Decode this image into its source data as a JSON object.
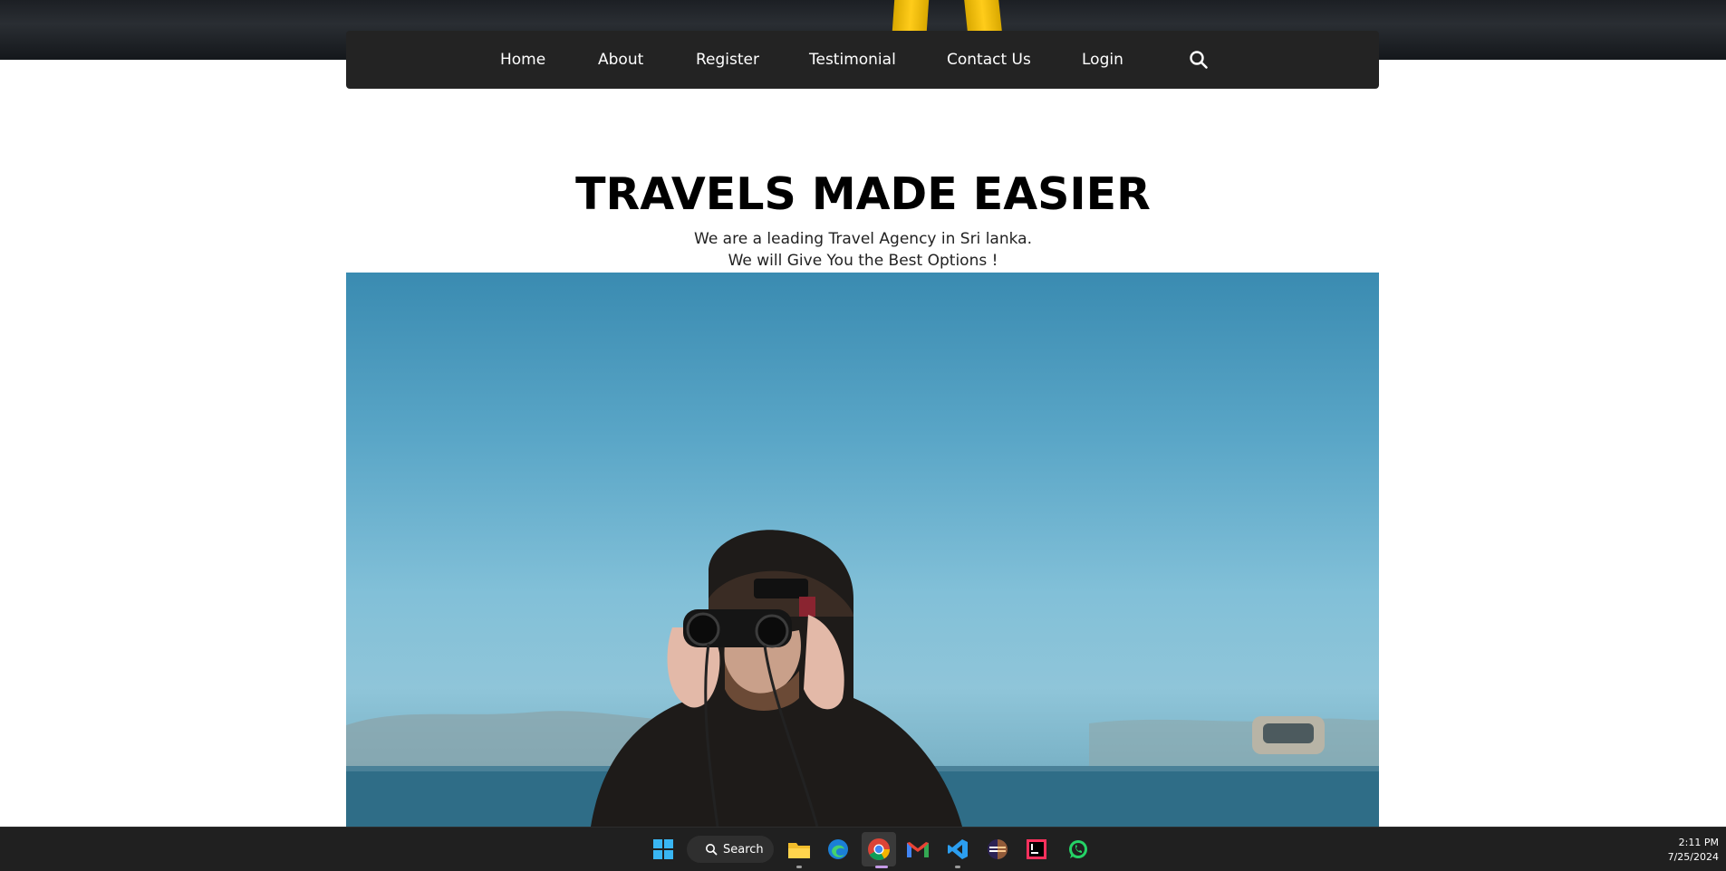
{
  "nav": {
    "items": [
      "Home",
      "About",
      "Register",
      "Testimonial",
      "Contact Us",
      "Login"
    ],
    "search_icon": "search-icon"
  },
  "hero": {
    "title": "TRAVELS MADE EASIER",
    "line1": "We are a leading Travel Agency in Sri lanka.",
    "line2": "We will Give You the Best Options !"
  },
  "taskbar": {
    "search_label": "Search",
    "time": "2:11 PM",
    "date": "7/25/2024",
    "apps": [
      "windows-start-icon",
      "file-explorer-icon",
      "edge-icon",
      "chrome-icon",
      "gmail-icon",
      "vscode-icon",
      "eclipse-icon",
      "intellij-icon",
      "whatsapp-icon"
    ]
  },
  "colors": {
    "navbar_bg": "#232323",
    "taskbar_bg": "#202020",
    "accent_yellow": "#ffcc1a"
  }
}
